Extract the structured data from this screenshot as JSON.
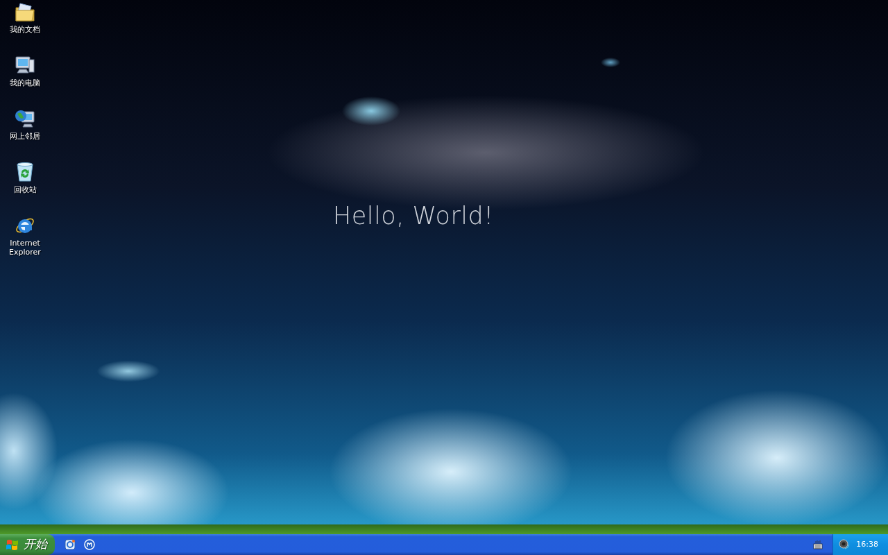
{
  "desktop_icons": [
    {
      "label": "我的文档",
      "kind": "documents"
    },
    {
      "label": "我的电脑",
      "kind": "computer"
    },
    {
      "label": "网上邻居",
      "kind": "network"
    },
    {
      "label": "回收站",
      "kind": "recycle"
    },
    {
      "label": "Internet Explorer",
      "kind": "browser"
    }
  ],
  "wallpaper": {
    "caption": "Hello, World!"
  },
  "taskbar": {
    "start_button": "开始",
    "clock": "16:38"
  }
}
